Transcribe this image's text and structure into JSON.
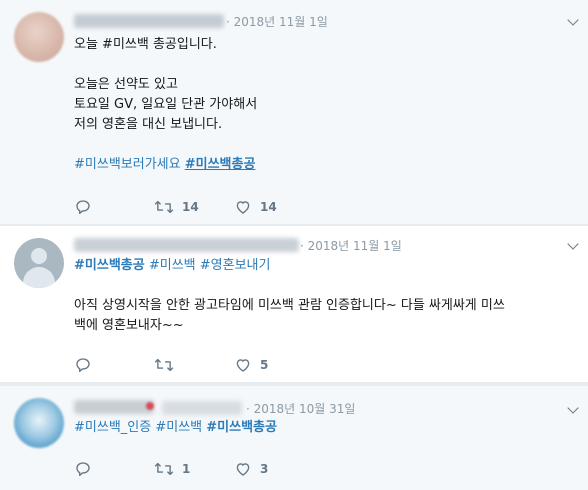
{
  "tweets": [
    {
      "date": "· 2018년 11월 1일",
      "body": "오늘 #미쓰백 총공입니다.\n\n오늘은 선약도 있고\n토요일 GV, 일요일 단관 가야해서\n저의 영혼을 대신 보냅니다.",
      "hashtags": [
        "#미쓰백보러가세요",
        "#미쓰백총공"
      ],
      "reply_count": "",
      "retweet_count": "14",
      "like_count": "14"
    },
    {
      "date": "· 2018년 11월 1일",
      "hashtags": [
        "#미쓰백총공",
        "#미쓰백",
        "#영혼보내기"
      ],
      "body": "아직 상영시작을 안한 광고타임에 미쓰백 관람 인증합니다~ 다들 싸게싸게 미쓰\n백에 영혼보내자~~",
      "reply_count": "",
      "retweet_count": "",
      "like_count": "5"
    },
    {
      "date": "· 2018년 10월 31일",
      "hashtags": [
        "#미쓰백_인증",
        "#미쓰백",
        "#미쓰백총공"
      ],
      "reply_count": "",
      "retweet_count": "1",
      "like_count": "3"
    }
  ],
  "colors": {
    "link": "#2b7bb9",
    "muted": "#657786",
    "bg_alt": "#f5f8fa",
    "divider": "#e6ecf0"
  },
  "icons": [
    "reply-icon",
    "retweet-icon",
    "like-icon",
    "chevron-down-icon",
    "avatar-icon"
  ]
}
